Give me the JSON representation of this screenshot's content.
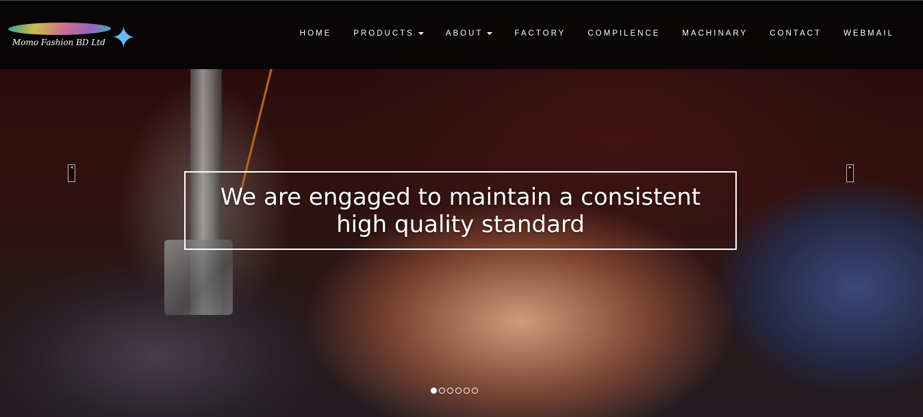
{
  "brand": {
    "name": "Momo Fashion BD Ltd"
  },
  "nav": {
    "items": [
      {
        "label": "HOME",
        "dropdown": false
      },
      {
        "label": "PRODUCTS",
        "dropdown": true
      },
      {
        "label": "ABOUT",
        "dropdown": true
      },
      {
        "label": "FACTORY",
        "dropdown": false
      },
      {
        "label": "COMPILENCE",
        "dropdown": false
      },
      {
        "label": "MACHINARY",
        "dropdown": false
      },
      {
        "label": "CONTACT",
        "dropdown": false
      },
      {
        "label": "WEBMAIL",
        "dropdown": false
      }
    ]
  },
  "slider": {
    "caption": "We are engaged to maintain a consistent high quality standard",
    "prev_icon": "arrow-left-icon",
    "next_icon": "arrow-right-icon",
    "slide_count": 6,
    "active_index": 0
  },
  "colors": {
    "header_bg": "#050505",
    "text": "#ffffff",
    "logo_figure": "#6ab8f0"
  }
}
